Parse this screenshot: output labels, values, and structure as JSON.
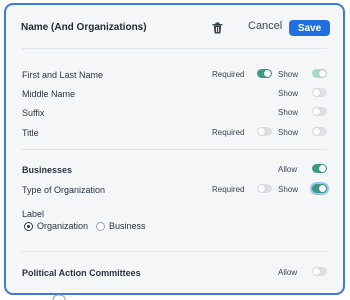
{
  "header": {
    "title": "Name (And Organizations)",
    "cancel_label": "Cancel",
    "save_label": "Save",
    "trash_icon": "trash-icon"
  },
  "name_fields": [
    {
      "label": "First and Last Name",
      "required_label": "Required",
      "required_on": true,
      "show_label": "Show",
      "show_on": true
    },
    {
      "label": "Middle Name",
      "show_label": "Show",
      "show_on": false
    },
    {
      "label": "Suffix",
      "show_label": "Show",
      "show_on": false
    },
    {
      "label": "Title",
      "required_label": "Required",
      "required_on": false,
      "show_label": "Show",
      "show_on": false
    }
  ],
  "businesses": {
    "label": "Businesses",
    "allow_label": "Allow",
    "allow_on": true,
    "type_field": {
      "label": "Type of Organization",
      "required_label": "Required",
      "required_on": false,
      "show_label": "Show",
      "show_on": true
    },
    "label_section": {
      "label": "Label",
      "options": [
        "Organization",
        "Business"
      ],
      "selected": "Organization"
    }
  },
  "pac": {
    "label": "Political Action Committees",
    "allow_label": "Allow",
    "allow_on": false
  },
  "colors": {
    "accent": "#1f6fe0",
    "border": "#3d7bd9",
    "toggle_on": "#3d9a84",
    "toggle_on_light": "#a8d9cb",
    "toggle_off": "#dde1e6"
  }
}
